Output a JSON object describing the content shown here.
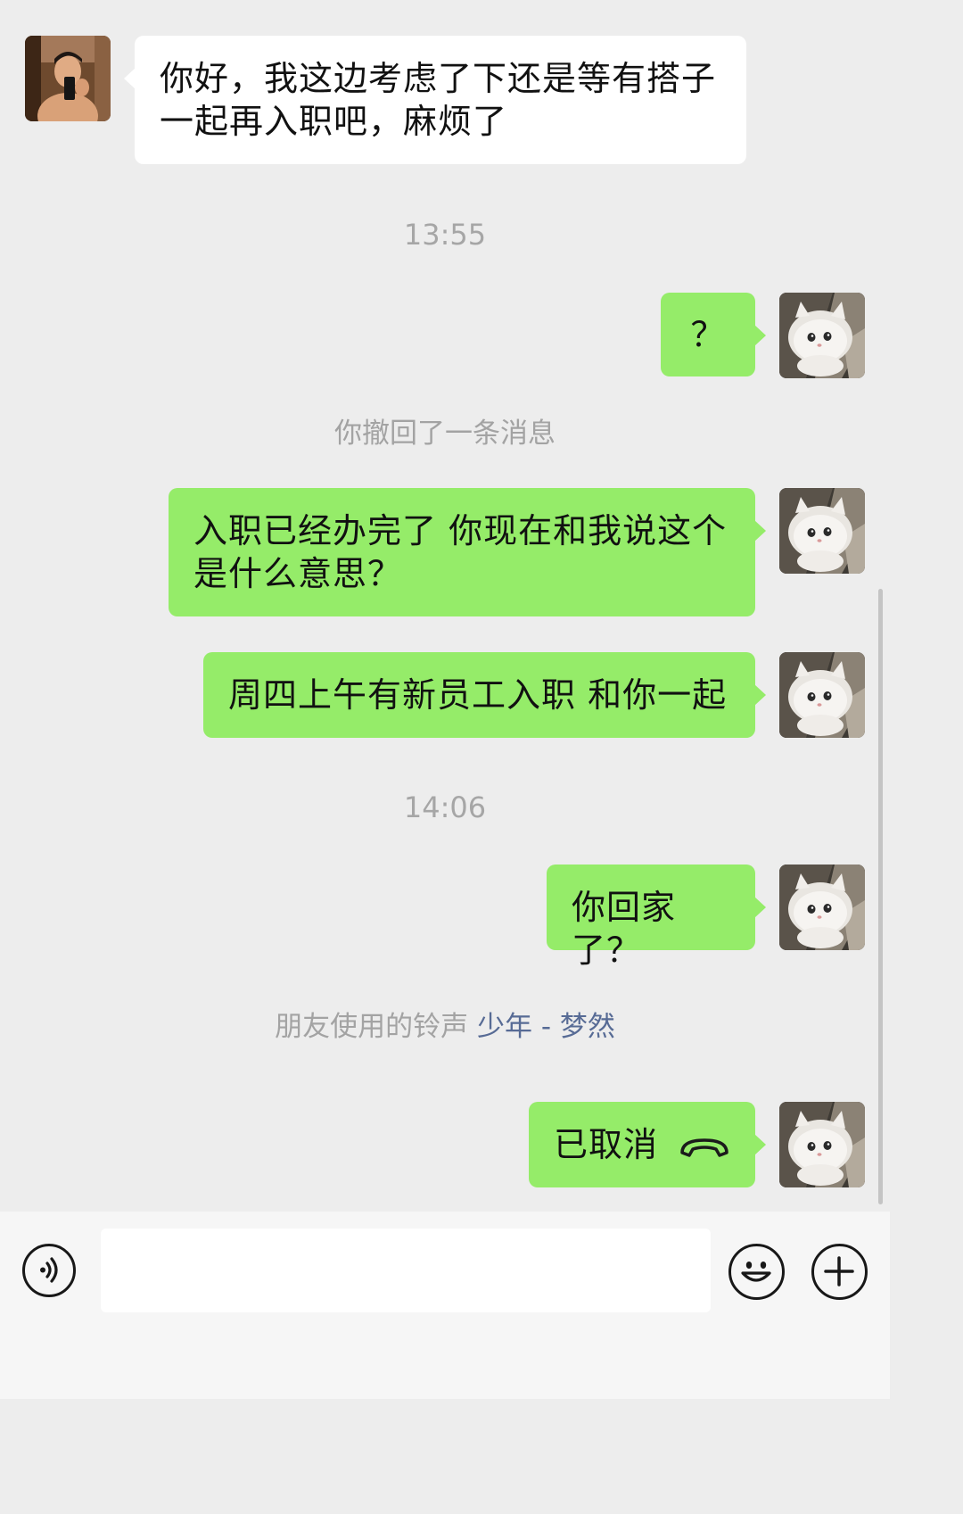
{
  "messages": [
    {
      "type": "incoming",
      "lines": [
        "你好，我这边考虑了下还是等有搭子",
        "一起再入职吧，麻烦了"
      ],
      "avatar_icon": "user-photo-avatar"
    },
    {
      "type": "timestamp",
      "text": "13:55"
    },
    {
      "type": "outgoing",
      "text": "？",
      "avatar_icon": "white-cat-avatar"
    },
    {
      "type": "system",
      "text": "你撤回了一条消息"
    },
    {
      "type": "outgoing",
      "lines": [
        "入职已经办完了 你现在和我说这个",
        "是什么意思？"
      ],
      "avatar_icon": "white-cat-avatar"
    },
    {
      "type": "outgoing",
      "text": "周四上午有新员工入职 和你一起",
      "avatar_icon": "white-cat-avatar"
    },
    {
      "type": "timestamp",
      "text": "14:06"
    },
    {
      "type": "outgoing",
      "text": "你回家了？",
      "avatar_icon": "white-cat-avatar"
    },
    {
      "type": "ringtone",
      "prefix": "朋友使用的铃声",
      "song": "少年 - 梦然"
    },
    {
      "type": "outgoing-call",
      "text": "已取消",
      "icon": "phone-hangup-icon",
      "avatar_icon": "white-cat-avatar"
    }
  ],
  "input_bar": {
    "voice_icon": "voice-icon",
    "emoji_icon": "emoji-icon",
    "plus_icon": "plus-icon",
    "input_value": ""
  },
  "colors": {
    "background": "#ededed",
    "outgoing_bubble": "#95ec69",
    "incoming_bubble": "#ffffff",
    "system_text": "#a3a3a3",
    "link_text": "#576b95",
    "input_bar": "#f6f6f6"
  }
}
